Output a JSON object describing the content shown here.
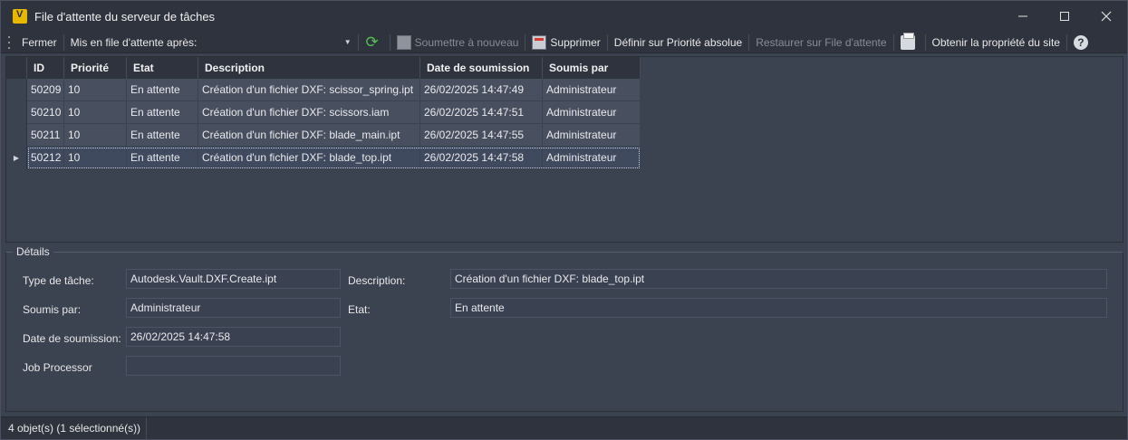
{
  "window": {
    "title": "File d'attente du serveur de tâches",
    "icon": "vault-app-icon",
    "controls": [
      "minimize",
      "maximize",
      "close"
    ]
  },
  "toolbar": {
    "close_label": "Fermer",
    "queued_after_label": "Mis en file d'attente après:",
    "resubmit_label": "Soumettre à nouveau",
    "delete_label": "Supprimer",
    "absolute_priority_label": "Définir sur Priorité absolue",
    "restore_queue_label": "Restaurer sur File d'attente",
    "site_ownership_label": "Obtenir la propriété du site"
  },
  "grid": {
    "columns": [
      "ID",
      "Priorité",
      "Etat",
      "Description",
      "Date de soumission",
      "Soumis par"
    ],
    "rows": [
      {
        "id": "50209",
        "priority": "10",
        "state": "En attente",
        "description": "Création d'un fichier DXF: scissor_spring.ipt",
        "date": "26/02/2025 14:47:49",
        "by": "Administrateur"
      },
      {
        "id": "50210",
        "priority": "10",
        "state": "En attente",
        "description": "Création d'un fichier DXF: scissors.iam",
        "date": "26/02/2025 14:47:51",
        "by": "Administrateur"
      },
      {
        "id": "50211",
        "priority": "10",
        "state": "En attente",
        "description": "Création d'un fichier DXF: blade_main.ipt",
        "date": "26/02/2025 14:47:55",
        "by": "Administrateur"
      },
      {
        "id": "50212",
        "priority": "10",
        "state": "En attente",
        "description": "Création d'un fichier DXF: blade_top.ipt",
        "date": "26/02/2025 14:47:58",
        "by": "Administrateur"
      }
    ],
    "selected_row": 3
  },
  "details": {
    "legend": "Détails",
    "task_type_label": "Type de tâche:",
    "task_type_value": "Autodesk.Vault.DXF.Create.ipt",
    "submitted_by_label": "Soumis par:",
    "submitted_by_value": "Administrateur",
    "submit_date_label": "Date de soumission:",
    "submit_date_value": "26/02/2025 14:47:58",
    "job_processor_label": "Job Processor",
    "job_processor_value": "",
    "description_label": "Description:",
    "description_value": "Création d'un fichier DXF: blade_top.ipt",
    "state_label": "Etat:",
    "state_value": "En attente"
  },
  "statusbar": {
    "text": "4 objet(s) (1 sélectionné(s))"
  }
}
